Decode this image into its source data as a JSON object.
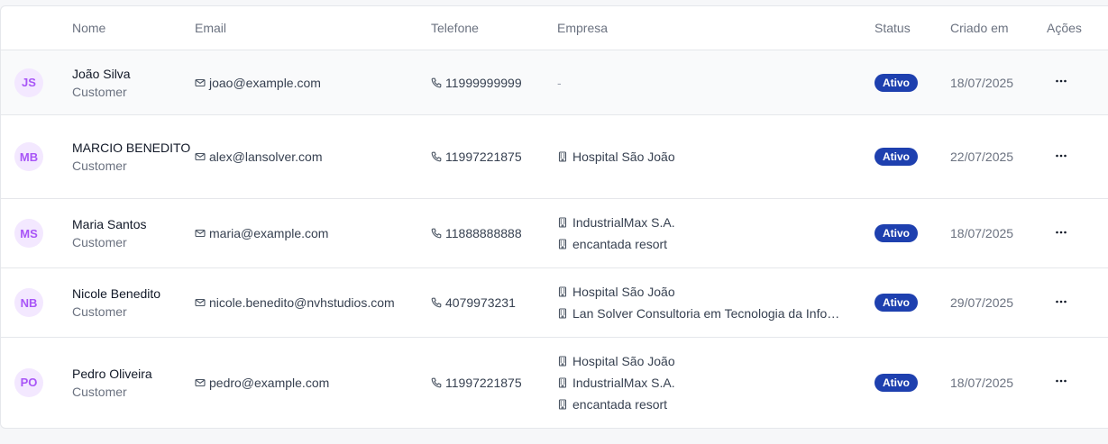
{
  "columns": {
    "name": "Nome",
    "email": "Email",
    "phone": "Telefone",
    "company": "Empresa",
    "status": "Status",
    "created": "Criado em",
    "actions": "Ações"
  },
  "colors": {
    "avatar_bg": "#f3e8ff",
    "avatar_text": "#a855f7",
    "status_badge": "#1e40af"
  },
  "rows": [
    {
      "initials": "JS",
      "name": "João Silva",
      "role": "Customer",
      "email": "joao@example.com",
      "phone": "11999999999",
      "companies": [],
      "empty_company": "-",
      "status": "Ativo",
      "created": "18/07/2025"
    },
    {
      "initials": "MB",
      "name": "MARCIO BENEDITO",
      "role": "Customer",
      "email": "alex@lansolver.com",
      "phone": "11997221875",
      "companies": [
        "Hospital São João"
      ],
      "status": "Ativo",
      "created": "22/07/2025"
    },
    {
      "initials": "MS",
      "name": "Maria Santos",
      "role": "Customer",
      "email": "maria@example.com",
      "phone": "11888888888",
      "companies": [
        "IndustrialMax S.A.",
        "encantada resort"
      ],
      "status": "Ativo",
      "created": "18/07/2025"
    },
    {
      "initials": "NB",
      "name": "Nicole Benedito",
      "role": "Customer",
      "email": "nicole.benedito@nvhstudios.com",
      "phone": "4079973231",
      "companies": [
        "Hospital São João",
        "Lan Solver Consultoria em Tecnologia da Info…"
      ],
      "status": "Ativo",
      "created": "29/07/2025"
    },
    {
      "initials": "PO",
      "name": "Pedro Oliveira",
      "role": "Customer",
      "email": "pedro@example.com",
      "phone": "11997221875",
      "companies": [
        "Hospital São João",
        "IndustrialMax S.A.",
        "encantada resort"
      ],
      "status": "Ativo",
      "created": "18/07/2025"
    }
  ],
  "icons": {
    "email": "mail-icon",
    "phone": "phone-icon",
    "company": "building-icon",
    "actions": "more-horizontal-icon"
  }
}
